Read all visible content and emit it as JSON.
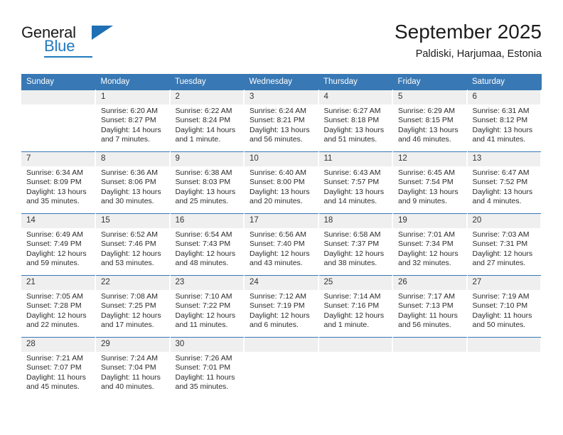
{
  "brand": {
    "line1": "General",
    "line2": "Blue",
    "logo_icon": "triangle-logo-icon"
  },
  "header": {
    "title": "September 2025",
    "location": "Paldiski, Harjumaa, Estonia"
  },
  "colors": {
    "header_blue": "#3878b4",
    "brand_blue": "#1f7ac0",
    "daynum_bg": "#efefef",
    "text": "#2b2b2b"
  },
  "weekday_headers": [
    "Sunday",
    "Monday",
    "Tuesday",
    "Wednesday",
    "Thursday",
    "Friday",
    "Saturday"
  ],
  "labels": {
    "sunrise_prefix": "Sunrise:",
    "sunset_prefix": "Sunset:",
    "daylight_prefix": "Daylight:"
  },
  "weeks": [
    [
      {
        "day": "",
        "blank": true
      },
      {
        "day": "1",
        "sunrise": "Sunrise: 6:20 AM",
        "sunset": "Sunset: 8:27 PM",
        "daylight_line1": "Daylight: 14 hours",
        "daylight_line2": "and 7 minutes."
      },
      {
        "day": "2",
        "sunrise": "Sunrise: 6:22 AM",
        "sunset": "Sunset: 8:24 PM",
        "daylight_line1": "Daylight: 14 hours",
        "daylight_line2": "and 1 minute."
      },
      {
        "day": "3",
        "sunrise": "Sunrise: 6:24 AM",
        "sunset": "Sunset: 8:21 PM",
        "daylight_line1": "Daylight: 13 hours",
        "daylight_line2": "and 56 minutes."
      },
      {
        "day": "4",
        "sunrise": "Sunrise: 6:27 AM",
        "sunset": "Sunset: 8:18 PM",
        "daylight_line1": "Daylight: 13 hours",
        "daylight_line2": "and 51 minutes."
      },
      {
        "day": "5",
        "sunrise": "Sunrise: 6:29 AM",
        "sunset": "Sunset: 8:15 PM",
        "daylight_line1": "Daylight: 13 hours",
        "daylight_line2": "and 46 minutes."
      },
      {
        "day": "6",
        "sunrise": "Sunrise: 6:31 AM",
        "sunset": "Sunset: 8:12 PM",
        "daylight_line1": "Daylight: 13 hours",
        "daylight_line2": "and 41 minutes."
      }
    ],
    [
      {
        "day": "7",
        "sunrise": "Sunrise: 6:34 AM",
        "sunset": "Sunset: 8:09 PM",
        "daylight_line1": "Daylight: 13 hours",
        "daylight_line2": "and 35 minutes."
      },
      {
        "day": "8",
        "sunrise": "Sunrise: 6:36 AM",
        "sunset": "Sunset: 8:06 PM",
        "daylight_line1": "Daylight: 13 hours",
        "daylight_line2": "and 30 minutes."
      },
      {
        "day": "9",
        "sunrise": "Sunrise: 6:38 AM",
        "sunset": "Sunset: 8:03 PM",
        "daylight_line1": "Daylight: 13 hours",
        "daylight_line2": "and 25 minutes."
      },
      {
        "day": "10",
        "sunrise": "Sunrise: 6:40 AM",
        "sunset": "Sunset: 8:00 PM",
        "daylight_line1": "Daylight: 13 hours",
        "daylight_line2": "and 20 minutes."
      },
      {
        "day": "11",
        "sunrise": "Sunrise: 6:43 AM",
        "sunset": "Sunset: 7:57 PM",
        "daylight_line1": "Daylight: 13 hours",
        "daylight_line2": "and 14 minutes."
      },
      {
        "day": "12",
        "sunrise": "Sunrise: 6:45 AM",
        "sunset": "Sunset: 7:54 PM",
        "daylight_line1": "Daylight: 13 hours",
        "daylight_line2": "and 9 minutes."
      },
      {
        "day": "13",
        "sunrise": "Sunrise: 6:47 AM",
        "sunset": "Sunset: 7:52 PM",
        "daylight_line1": "Daylight: 13 hours",
        "daylight_line2": "and 4 minutes."
      }
    ],
    [
      {
        "day": "14",
        "sunrise": "Sunrise: 6:49 AM",
        "sunset": "Sunset: 7:49 PM",
        "daylight_line1": "Daylight: 12 hours",
        "daylight_line2": "and 59 minutes."
      },
      {
        "day": "15",
        "sunrise": "Sunrise: 6:52 AM",
        "sunset": "Sunset: 7:46 PM",
        "daylight_line1": "Daylight: 12 hours",
        "daylight_line2": "and 53 minutes."
      },
      {
        "day": "16",
        "sunrise": "Sunrise: 6:54 AM",
        "sunset": "Sunset: 7:43 PM",
        "daylight_line1": "Daylight: 12 hours",
        "daylight_line2": "and 48 minutes."
      },
      {
        "day": "17",
        "sunrise": "Sunrise: 6:56 AM",
        "sunset": "Sunset: 7:40 PM",
        "daylight_line1": "Daylight: 12 hours",
        "daylight_line2": "and 43 minutes."
      },
      {
        "day": "18",
        "sunrise": "Sunrise: 6:58 AM",
        "sunset": "Sunset: 7:37 PM",
        "daylight_line1": "Daylight: 12 hours",
        "daylight_line2": "and 38 minutes."
      },
      {
        "day": "19",
        "sunrise": "Sunrise: 7:01 AM",
        "sunset": "Sunset: 7:34 PM",
        "daylight_line1": "Daylight: 12 hours",
        "daylight_line2": "and 32 minutes."
      },
      {
        "day": "20",
        "sunrise": "Sunrise: 7:03 AM",
        "sunset": "Sunset: 7:31 PM",
        "daylight_line1": "Daylight: 12 hours",
        "daylight_line2": "and 27 minutes."
      }
    ],
    [
      {
        "day": "21",
        "sunrise": "Sunrise: 7:05 AM",
        "sunset": "Sunset: 7:28 PM",
        "daylight_line1": "Daylight: 12 hours",
        "daylight_line2": "and 22 minutes."
      },
      {
        "day": "22",
        "sunrise": "Sunrise: 7:08 AM",
        "sunset": "Sunset: 7:25 PM",
        "daylight_line1": "Daylight: 12 hours",
        "daylight_line2": "and 17 minutes."
      },
      {
        "day": "23",
        "sunrise": "Sunrise: 7:10 AM",
        "sunset": "Sunset: 7:22 PM",
        "daylight_line1": "Daylight: 12 hours",
        "daylight_line2": "and 11 minutes."
      },
      {
        "day": "24",
        "sunrise": "Sunrise: 7:12 AM",
        "sunset": "Sunset: 7:19 PM",
        "daylight_line1": "Daylight: 12 hours",
        "daylight_line2": "and 6 minutes."
      },
      {
        "day": "25",
        "sunrise": "Sunrise: 7:14 AM",
        "sunset": "Sunset: 7:16 PM",
        "daylight_line1": "Daylight: 12 hours",
        "daylight_line2": "and 1 minute."
      },
      {
        "day": "26",
        "sunrise": "Sunrise: 7:17 AM",
        "sunset": "Sunset: 7:13 PM",
        "daylight_line1": "Daylight: 11 hours",
        "daylight_line2": "and 56 minutes."
      },
      {
        "day": "27",
        "sunrise": "Sunrise: 7:19 AM",
        "sunset": "Sunset: 7:10 PM",
        "daylight_line1": "Daylight: 11 hours",
        "daylight_line2": "and 50 minutes."
      }
    ],
    [
      {
        "day": "28",
        "sunrise": "Sunrise: 7:21 AM",
        "sunset": "Sunset: 7:07 PM",
        "daylight_line1": "Daylight: 11 hours",
        "daylight_line2": "and 45 minutes."
      },
      {
        "day": "29",
        "sunrise": "Sunrise: 7:24 AM",
        "sunset": "Sunset: 7:04 PM",
        "daylight_line1": "Daylight: 11 hours",
        "daylight_line2": "and 40 minutes."
      },
      {
        "day": "30",
        "sunrise": "Sunrise: 7:26 AM",
        "sunset": "Sunset: 7:01 PM",
        "daylight_line1": "Daylight: 11 hours",
        "daylight_line2": "and 35 minutes."
      },
      {
        "day": "",
        "blank": true
      },
      {
        "day": "",
        "blank": true
      },
      {
        "day": "",
        "blank": true
      },
      {
        "day": "",
        "blank": true
      }
    ]
  ]
}
